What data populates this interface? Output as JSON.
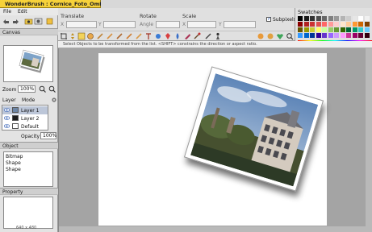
{
  "window": {
    "title": "WonderBrush : Cornice_Foto_Ombre"
  },
  "menu": {
    "file": "File",
    "edit": "Edit"
  },
  "sections": {
    "canvas": "Canvas",
    "object": "Object",
    "property": "Property"
  },
  "navigator": {
    "zoom_label": "Zoom",
    "zoom_value": "100%"
  },
  "layers": {
    "col_layer": "Layer",
    "col_mode": "Mode",
    "items": [
      {
        "name": "Layer 1",
        "selected": true
      },
      {
        "name": "Layer 2",
        "selected": false
      },
      {
        "name": "Default",
        "selected": false
      }
    ],
    "opacity_label": "Opacity",
    "opacity_value": "100%"
  },
  "objects": {
    "items": [
      "Bitmap",
      "Shape",
      "Shape"
    ]
  },
  "canvas_size": "640 x 480",
  "transform": {
    "translate_label": "Translate",
    "x_label": "X",
    "y_label": "Y",
    "rotate_label": "Rotate",
    "angle_label": "Angle",
    "scale_label": "Scale",
    "subpixels_label": "Subpixels",
    "subpixels_checked": true
  },
  "swatches": {
    "title": "Swatches",
    "colors": [
      "#000000",
      "#1a1a1a",
      "#333333",
      "#4d4d4d",
      "#666666",
      "#808080",
      "#999999",
      "#b3b3b3",
      "#cccccc",
      "#e6e6e6",
      "#ffffff",
      "#f0f0f0",
      "#8b0000",
      "#b22222",
      "#cc3333",
      "#e05050",
      "#ff6666",
      "#ff9999",
      "#ffcccc",
      "#ffe6cc",
      "#ffcc99",
      "#ff9933",
      "#cc6600",
      "#804000",
      "#665500",
      "#999900",
      "#cccc33",
      "#ffff66",
      "#ccff99",
      "#99cc66",
      "#669933",
      "#336600",
      "#006633",
      "#009966",
      "#33cccc",
      "#66ccff",
      "#3399ff",
      "#0066cc",
      "#003399",
      "#330099",
      "#6633cc",
      "#9966ff",
      "#cc99ff",
      "#ff99ff",
      "#cc3399",
      "#990066",
      "#660033",
      "#330011"
    ]
  },
  "status": {
    "message": "Select Objects to be transformed from the list. <SHIFT> constrains the direction or aspect ratio."
  },
  "tool_icons": [
    "crop-icon",
    "move-icon",
    "transform-icon",
    "brush-icon",
    "pen-icon",
    "eraser-icon",
    "clone-icon",
    "blur-icon",
    "fill-icon",
    "text-icon",
    "shape-icon",
    "bucket-icon",
    "drop-icon",
    "smudge-icon",
    "pick-icon",
    "select-icon",
    "eyedropper-icon",
    "edit-gradient-icon"
  ]
}
